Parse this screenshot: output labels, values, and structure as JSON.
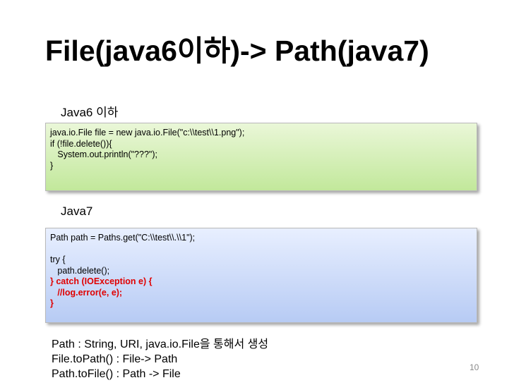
{
  "title": "File(java6이하)-> Path(java7)",
  "section_java6": "Java6 이하",
  "section_java7": "Java7",
  "code_java6": [
    "java.io.File file = new java.io.File(\"c:\\\\test\\\\1.png\");",
    "if (!file.delete()){",
    "   System.out.println(\"???\");",
    "}"
  ],
  "code_java7": [
    "Path path = Paths.get(\"C:\\\\test\\\\.\\\\1\");",
    "",
    "try {",
    "   path.delete();",
    "} catch (IOException e) {",
    "   //log.error(e, e);",
    "}"
  ],
  "notes": [
    "Path : String, URI, java.io.File을 통해서 생성",
    "File.toPath() : File-> Path",
    "Path.toFile() : Path -> File"
  ],
  "page_number": "10",
  "colors": {
    "green_box": "#c2e89b",
    "blue_box": "#b7cbf4",
    "highlight_red": "#e00000"
  }
}
